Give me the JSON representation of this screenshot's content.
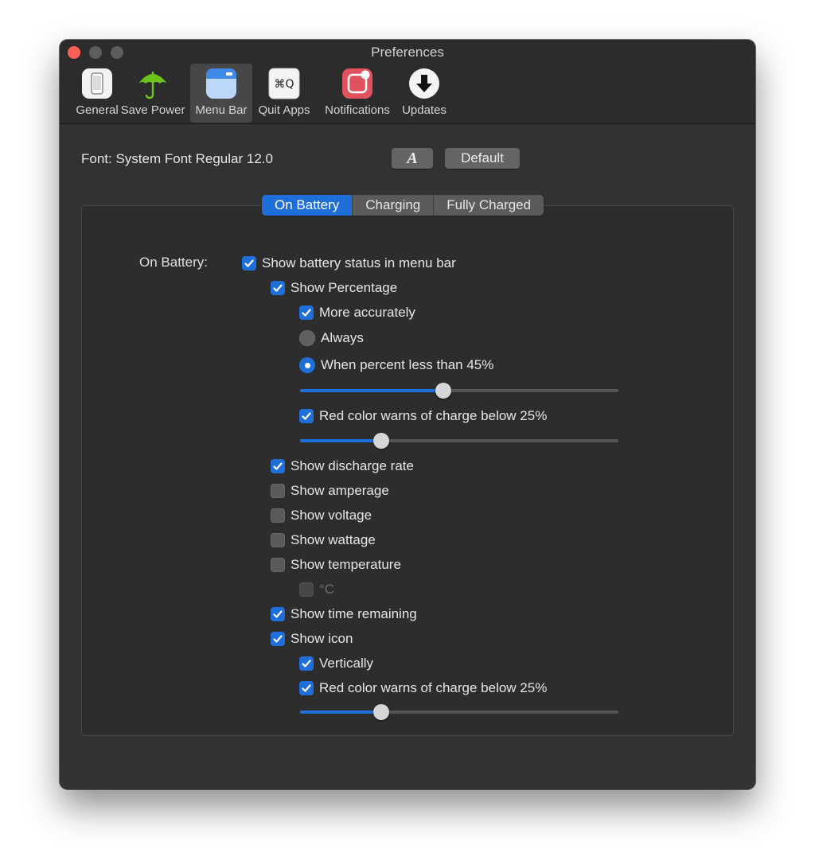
{
  "window": {
    "title": "Preferences",
    "toolbar": [
      {
        "label": "General",
        "icon": "phone-icon"
      },
      {
        "label": "Save Power",
        "icon": "umbrella-icon"
      },
      {
        "label": "Menu Bar",
        "icon": "menu-bar-icon"
      },
      {
        "label": "Quit Apps",
        "icon": "command-q-icon",
        "glyph": "⌘Q"
      },
      {
        "label": "Notifications",
        "icon": "notification-badge-icon"
      },
      {
        "label": "Updates",
        "icon": "download-arrow-icon"
      }
    ],
    "selected_toolbar": "Menu Bar"
  },
  "font_row": {
    "label": "Font: System Font Regular 12.0",
    "font_button": "A",
    "default_button": "Default"
  },
  "tabs": [
    "On Battery",
    "Charging",
    "Fully Charged"
  ],
  "active_tab": "On Battery",
  "section_label": "On Battery:",
  "options": {
    "show_battery_status": {
      "label": "Show battery status in menu bar",
      "checked": true
    },
    "show_percentage": {
      "label": "Show Percentage",
      "checked": true
    },
    "more_accurately": {
      "label": "More accurately",
      "checked": true
    },
    "always": {
      "label": "Always",
      "selected": false
    },
    "when_percent_less": {
      "label": "When percent less than 45%",
      "selected": true
    },
    "percent_slider": {
      "value_fraction": 0.45
    },
    "red_warn_percentage": {
      "label": "Red color warns of charge below 25%",
      "checked": true
    },
    "red_warn_percentage_slider": {
      "value_fraction": 0.255
    },
    "show_discharge_rate": {
      "label": "Show discharge rate",
      "checked": true
    },
    "show_amperage": {
      "label": "Show amperage",
      "checked": false
    },
    "show_voltage": {
      "label": "Show voltage",
      "checked": false
    },
    "show_wattage": {
      "label": "Show wattage",
      "checked": false
    },
    "show_temperature": {
      "label": "Show temperature",
      "checked": false
    },
    "celsius": {
      "label": "°C",
      "checked": false,
      "enabled": false
    },
    "show_time_remaining": {
      "label": "Show time remaining",
      "checked": true
    },
    "show_icon": {
      "label": "Show icon",
      "checked": true
    },
    "vertically": {
      "label": "Vertically",
      "checked": true
    },
    "red_warn_icon": {
      "label": "Red color warns of charge below 25%",
      "checked": true
    },
    "red_warn_icon_slider": {
      "value_fraction": 0.255
    }
  },
  "colors": {
    "accent": "#1e6fd9",
    "window_bg": "#323232",
    "close_button": "#ff5f57"
  }
}
